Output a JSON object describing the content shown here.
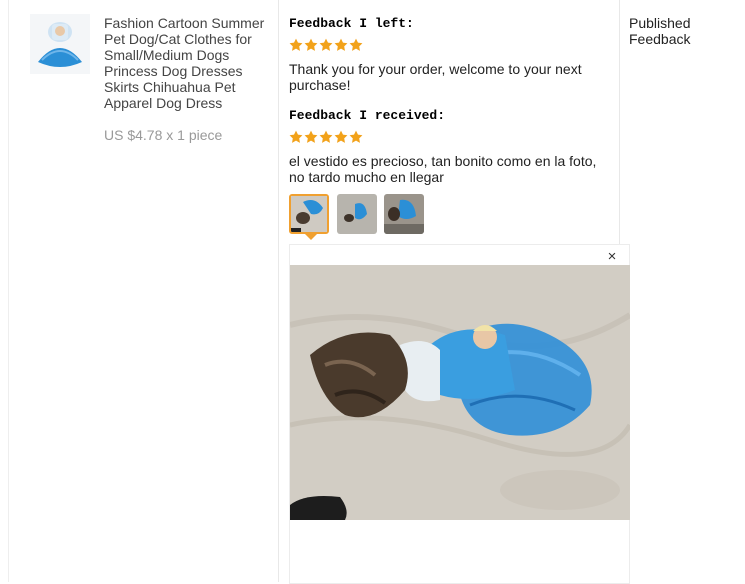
{
  "product": {
    "title": "Fashion Cartoon Summer Pet Dog/Cat Clothes for Small/Medium Dogs Princess Dog Dresses Skirts Chihuahua Pet Apparel Dog Dress",
    "price": "US $4.78 x 1 piece",
    "thumbnail_icon": "product-photo-blue-dress"
  },
  "feedback_left": {
    "heading": "Feedback I left:",
    "rating": 5,
    "text": "Thank you for your order,  welcome to your next purchase!"
  },
  "feedback_received": {
    "heading": "Feedback I received:",
    "rating": 5,
    "text": "el vestido es precioso, tan bonito como en la foto, no tardo mucho en llegar",
    "photos": [
      "buyer-photo-1",
      "buyer-photo-2",
      "buyer-photo-3"
    ],
    "selected_photo": 0
  },
  "status": {
    "label": "Published Feedback"
  },
  "preview": {
    "close_icon": "×",
    "image_icon": "dog-in-blue-tutu-photo"
  },
  "colors": {
    "star": "#f2a21a",
    "accent": "#f0a030",
    "border": "#e8e8e8",
    "dress_blue": "#2b8fd6"
  }
}
